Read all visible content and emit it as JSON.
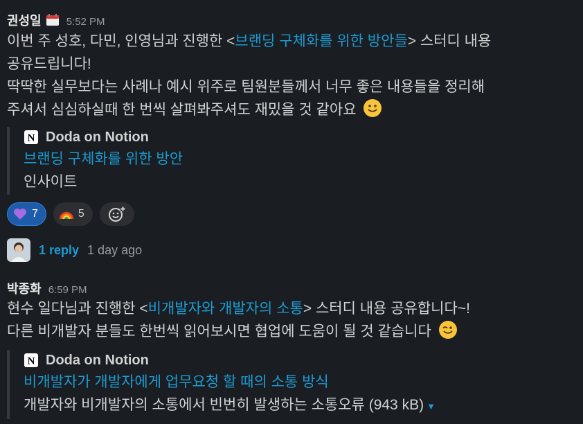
{
  "messages": [
    {
      "author": "권성일",
      "time": "5:52 PM",
      "status_icon": "calendar-icon",
      "lines": [
        {
          "pre": "이번 주 성호, 다민, 인영님과 진행한 <",
          "link": "브랜딩 구체화를 위한 방안들",
          "post": "> 스터디 내용"
        },
        {
          "text": "공유드립니다!"
        },
        {
          "text": "딱딱한 실무보다는 사례나 예시 위주로 팀원분들께서 너무 좋은 내용들을 정리해"
        },
        {
          "text": "주셔서 심심하실때 한 번씩 살펴봐주셔도 재밌을 것 같아요",
          "emoji": "slightly-smiling-face-icon"
        }
      ],
      "unfurl": {
        "source": "Doda on Notion",
        "title": "브랜딩 구체화를 위한 방안",
        "description": "인사이트"
      },
      "reactions": [
        {
          "emoji": "purple-heart-icon",
          "count": "7",
          "active": true
        },
        {
          "emoji": "rainbow-icon",
          "count": "5",
          "active": false
        }
      ],
      "thread": {
        "reply_count": "1 reply",
        "last_reply": "1 day ago"
      }
    },
    {
      "author": "박종화",
      "time": "6:59 PM",
      "lines": [
        {
          "pre": "현수 일다님과 진행한 <",
          "link": "비개발자와 개발자의 소통",
          "post": "> 스터디 내용 공유합니다~!"
        },
        {
          "text": "다른 비개발자 분들도 한번씩 읽어보시면 협업에 도움이 될 것 같습니다",
          "emoji": "winking-face-icon"
        }
      ],
      "unfurl": {
        "source": "Doda on Notion",
        "title": "비개발자가 개발자에게 업무요청 할 때의 소통 방식",
        "description": "개발자와 비개발자의 소통에서 빈번히 발생하는 소통오류",
        "size": "(943 kB)"
      }
    }
  ],
  "colors": {
    "background": "#1a1d21",
    "link": "#1d9bd1",
    "reaction_active": "#1e5ba8",
    "text": "#d1d2d3"
  }
}
